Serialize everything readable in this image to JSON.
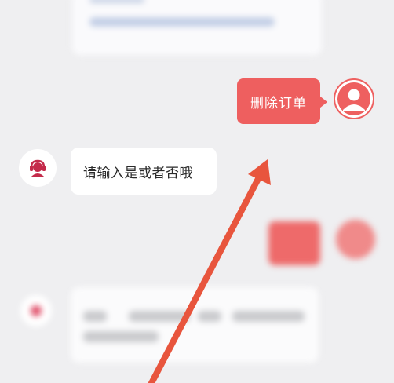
{
  "chat": {
    "user_message": "删除订单",
    "bot_message": "请输入是或者否哦"
  },
  "colors": {
    "accent_red": "#ee5f5f",
    "arrow": "#e8553d",
    "background": "#efeff1"
  },
  "icons": {
    "user_avatar": "user-avatar-icon",
    "bot_avatar": "customer-service-icon"
  }
}
